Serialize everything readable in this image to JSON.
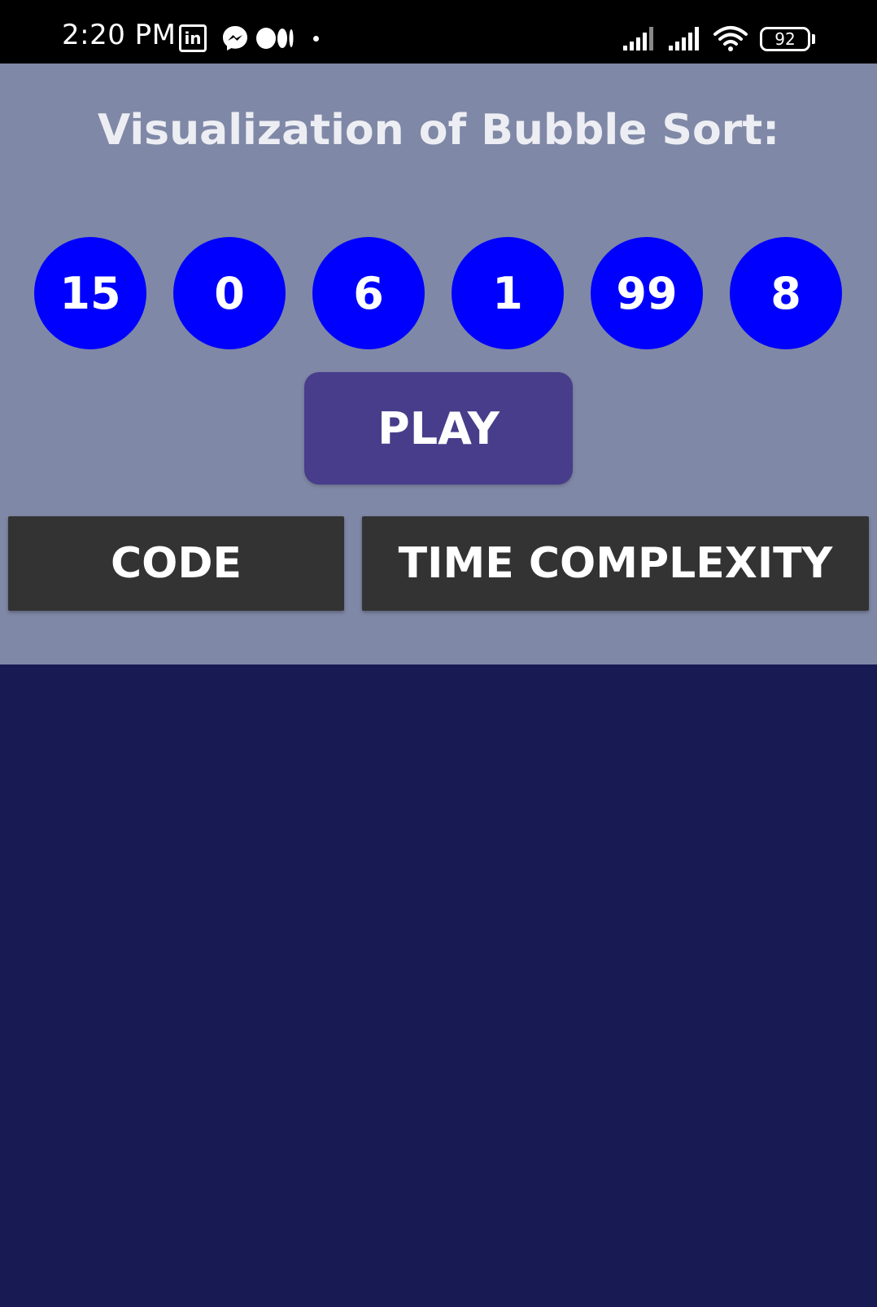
{
  "status_bar": {
    "time": "2:20 PM",
    "battery": "92",
    "icons": [
      "linkedin-icon",
      "messenger-icon",
      "medium-icon",
      "notification-dot",
      "signal-icon",
      "signal-icon",
      "wifi-icon",
      "battery-icon"
    ]
  },
  "title": "Visualization of Bubble Sort:",
  "array": [
    "15",
    "0",
    "6",
    "1",
    "99",
    "8"
  ],
  "buttons": {
    "play": "PLAY",
    "code": "CODE",
    "time_complexity": "TIME COMPLEXITY"
  },
  "colors": {
    "panel_background": "#7f88a6",
    "page_background": "#181a54",
    "bubble": "#0000ff",
    "play_button": "#473d8b",
    "dark_button": "#333333",
    "title_text": "#edeef3"
  }
}
